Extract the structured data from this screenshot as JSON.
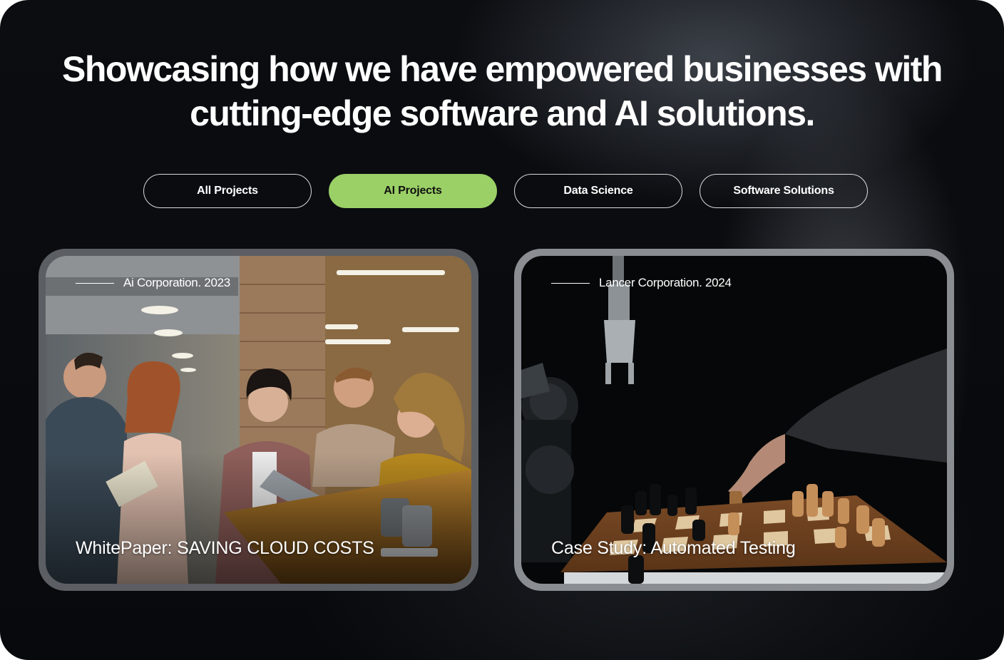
{
  "headline": {
    "line1": "Showcasing how we have empowered businesses with",
    "line2": "cutting-edge software and AI solutions."
  },
  "filters": [
    {
      "label": "All Projects",
      "active": false
    },
    {
      "label": "AI Projects",
      "active": true
    },
    {
      "label": "Data Science",
      "active": false
    },
    {
      "label": "Software Solutions",
      "active": false
    }
  ],
  "projects": [
    {
      "meta": "Ai Corporation. 2023",
      "title": "WhitePaper: SAVING CLOUD COSTS",
      "image": "team-collaboration-photo"
    },
    {
      "meta": "Lancer Corporation. 2024",
      "title": "Case Study: Automated Testing",
      "image": "robot-chess-photo"
    }
  ],
  "colors": {
    "accent": "#9bd066",
    "background": "#07090c",
    "text": "#ffffff"
  }
}
